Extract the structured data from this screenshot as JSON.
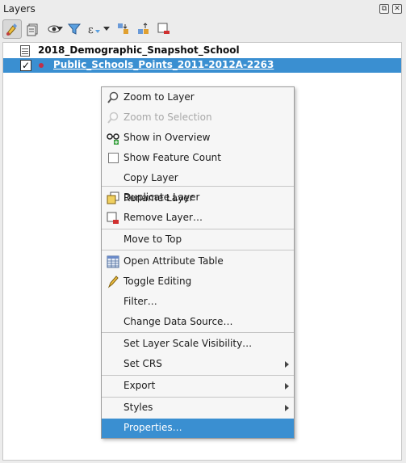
{
  "panel": {
    "title": "Layers",
    "float_icon": "float-icon",
    "close_icon": "close-icon"
  },
  "toolbar": {
    "items": [
      "style-manager-icon",
      "add-group-icon",
      "visibility-icon",
      "filter-icon",
      "expression-filter-icon",
      "expand-all-icon",
      "collapse-all-icon",
      "remove-layer-icon"
    ]
  },
  "tree": {
    "group_label": "2018_Demographic_Snapshot_School",
    "layer_label": "Public_Schools_Points_2011-2012A-2263",
    "layer_checked": "✓",
    "selected_color": "#3a8fd1"
  },
  "menu": {
    "zoom_to_layer": "Zoom to Layer",
    "zoom_to_selection": "Zoom to Selection",
    "show_in_overview": "Show in Overview",
    "show_feature_count": "Show Feature Count",
    "copy_layer": "Copy Layer",
    "rename_layer": "Rename Layer",
    "duplicate_layer": "Duplicate Layer",
    "remove_layer": "Remove Layer…",
    "move_to_top": "Move to Top",
    "open_attribute_table": "Open Attribute Table",
    "toggle_editing": "Toggle Editing",
    "filter": "Filter…",
    "change_data_source": "Change Data Source…",
    "set_layer_scale_visibility": "Set Layer Scale Visibility…",
    "set_crs": "Set CRS",
    "export": "Export",
    "styles": "Styles",
    "properties": "Properties…"
  }
}
